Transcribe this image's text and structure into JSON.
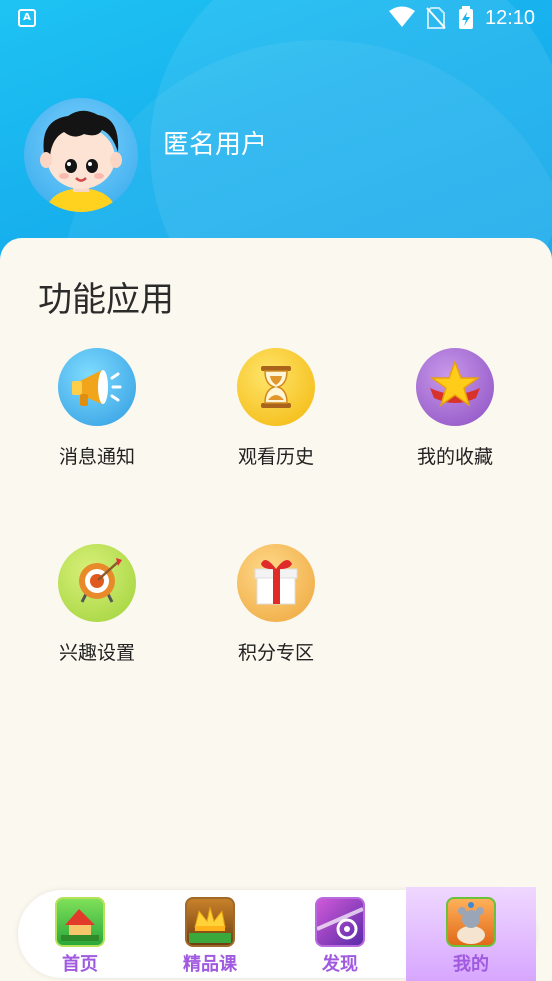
{
  "status_bar": {
    "time": "12:10",
    "app_badge": "A"
  },
  "profile": {
    "username": "匿名用户"
  },
  "section": {
    "title": "功能应用"
  },
  "features": [
    {
      "label": "消息通知",
      "icon": "megaphone-icon"
    },
    {
      "label": "观看历史",
      "icon": "hourglass-icon"
    },
    {
      "label": "我的收藏",
      "icon": "star-icon"
    },
    {
      "label": "兴趣设置",
      "icon": "target-icon"
    },
    {
      "label": "积分专区",
      "icon": "gift-icon"
    }
  ],
  "tabs": [
    {
      "label": "首页",
      "icon": "home-tab-icon"
    },
    {
      "label": "精品课",
      "icon": "crown-tab-icon"
    },
    {
      "label": "发现",
      "icon": "discover-tab-icon"
    },
    {
      "label": "我的",
      "icon": "mine-tab-icon",
      "active": true
    }
  ],
  "colors": {
    "header": "#18b2ee",
    "card_bg": "#fbf8ef",
    "tab_text": "#a05ae0",
    "tab_active_bg": "#d7a6ff"
  }
}
